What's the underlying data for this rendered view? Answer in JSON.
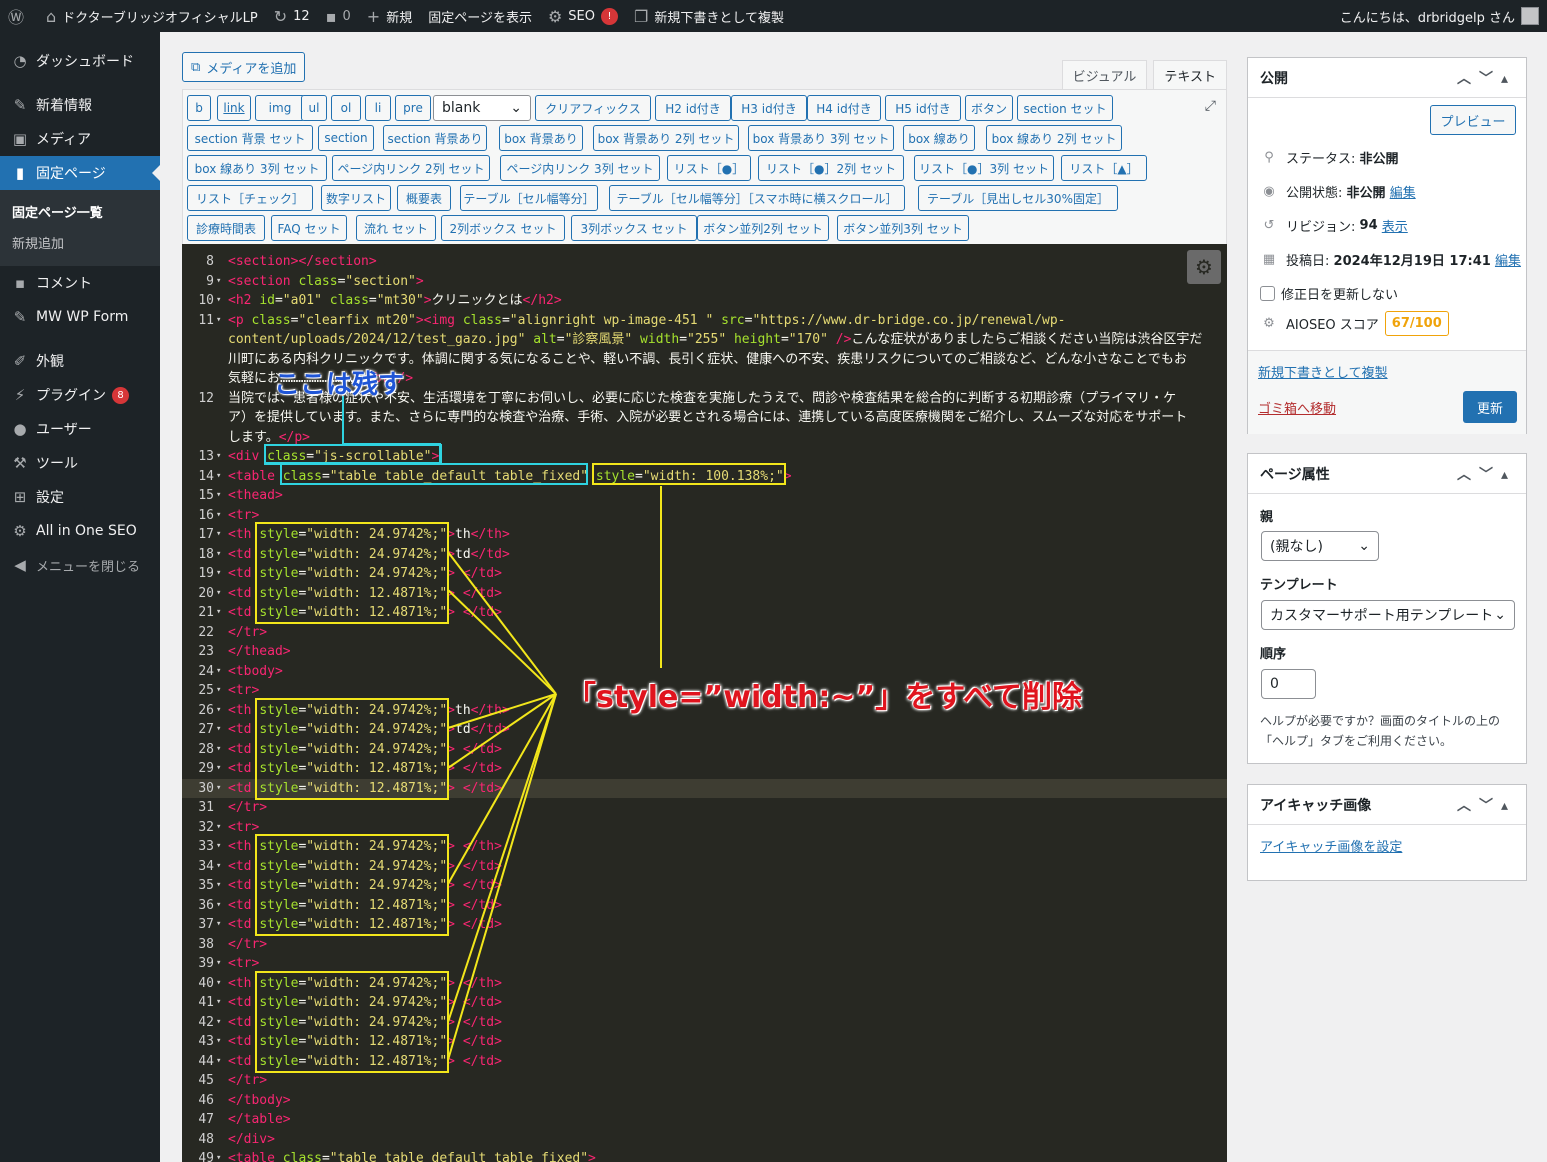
{
  "adminbar": {
    "site_name": "ドクターブリッジオフィシャルLP",
    "updates": "12",
    "comments": "0",
    "new": "新規",
    "view_page": "固定ページを表示",
    "seo": "SEO",
    "seo_badge": "!",
    "duplicate": "新規下書きとして複製",
    "greeting": "こんにちは、drbridgelp さん"
  },
  "sidebar": {
    "items": [
      {
        "label": "ダッシュボード",
        "icon": "dashboard-icon"
      },
      {
        "label": "新着情報",
        "icon": "pin-icon"
      },
      {
        "label": "メディア",
        "icon": "media-icon"
      },
      {
        "label": "固定ページ",
        "icon": "page-icon"
      },
      {
        "label": "コメント",
        "icon": "comment-icon"
      },
      {
        "label": "MW WP Form",
        "icon": "pin-icon"
      },
      {
        "label": "外観",
        "icon": "appearance-icon"
      },
      {
        "label": "プラグイン",
        "icon": "plugin-icon",
        "count": "8"
      },
      {
        "label": "ユーザー",
        "icon": "user-icon"
      },
      {
        "label": "ツール",
        "icon": "tool-icon"
      },
      {
        "label": "設定",
        "icon": "settings-icon"
      },
      {
        "label": "All in One SEO",
        "icon": "aioseo-icon"
      },
      {
        "label": "メニューを閉じる",
        "icon": "collapse-icon"
      }
    ],
    "submenu": [
      "固定ページ一覧",
      "新規追加"
    ]
  },
  "editor": {
    "add_media": "メディアを追加",
    "tab_visual": "ビジュアル",
    "tab_text": "テキスト",
    "quicktags": [
      "b",
      "link",
      "img",
      "ul",
      "ol",
      "li",
      "pre",
      "blank",
      "クリアフィックス",
      "H2 id付き",
      "H3 id付き",
      "H4 id付き",
      "H5 id付き",
      "ボタン",
      "section セット",
      "section 背景 セット",
      "section",
      "section 背景あり",
      "box 背景あり",
      "box 背景あり 2列 セット",
      "box 背景あり 3列 セット",
      "box 線あり",
      "box 線あり 2列 セット",
      "box 線あり 3列 セット",
      "ページ内リンク 2列 セット",
      "ページ内リンク 3列 セット",
      "リスト［●］",
      "リスト［●］2列 セット",
      "リスト［●］3列 セット",
      "リスト［▲］",
      "リスト［チェック］",
      "数字リスト",
      "概要表",
      "テーブル［セル幅等分］",
      "テーブル［セル幅等分］［スマホ時に横スクロール］",
      "テーブル［見出しセル30%固定］",
      "診療時間表",
      "FAQ セット",
      "流れ セット",
      "2列ボックス セット",
      "3列ボックス セット",
      "ボタン並列2列 セット",
      "ボタン並列3列 セット"
    ]
  },
  "code_lines": [
    {
      "n": "8",
      "a": "",
      "h": "<span class='tg'>&lt;section&gt;&lt;/section&gt;</span>"
    },
    {
      "n": "9",
      "a": "▾",
      "h": "<span class='tg'>&lt;section</span> <span class='at'>class</span>=<span class='st'>\"section\"</span><span class='tg'>&gt;</span>"
    },
    {
      "n": "10",
      "a": "▾",
      "h": "<span class='tg'>&lt;h2</span> <span class='at'>id</span>=<span class='st'>\"a01\"</span> <span class='at'>class</span>=<span class='st'>\"mt30\"</span><span class='tg'>&gt;</span>クリニックとは<span class='tg'>&lt;/h2&gt;</span>"
    },
    {
      "n": "11",
      "a": "▾",
      "h": "<span class='tg'>&lt;p</span> <span class='at'>class</span>=<span class='st'>\"clearfix mt20\"</span><span class='tg'>&gt;&lt;img</span> <span class='at'>class</span>=<span class='st'>\"alignright wp-image-451 \"</span> <span class='at'>src</span>=<span class='st'>\"https://www.dr-bridge.co.jp/renewal/wp-</span>"
    },
    {
      "n": "",
      "a": "",
      "h": "<span class='st'>content/uploads/2024/12/test_gazo.jpg\"</span> <span class='at'>alt</span>=<span class='st'>\"診察風景\"</span> <span class='at'>width</span>=<span class='st'>\"255\"</span> <span class='at'>height</span>=<span class='st'>\"170\"</span> <span class='tg'>/&gt;</span>こんな症状がありましたらご相談ください当院は渋谷区宇だ"
    },
    {
      "n": "",
      "a": "",
      "h": "川町にある内科クリニックです。体調に関する気になることや、軽い不調、長引く症状、健康への不安、疾患リスクについてのご相談など、どんな小さなことでもお"
    },
    {
      "n": "",
      "a": "",
      "h": "気軽にお……………………………<span class='tg'>&lt;br /&gt;</span>"
    },
    {
      "n": "12",
      "a": "",
      "h": "当院では、患者様の症状や不安、生活環境を丁寧にお伺いし、必要に応じた検査を実施したうえで、問診や検査結果を総合的に判断する初期診療（プライマリ・ケ"
    },
    {
      "n": "",
      "a": "",
      "h": "ア）を提供しています。また、さらに専門的な検査や治療、手術、入院が必要とされる場合には、連携している高度医療機関をご紹介し、スムーズな対応をサポート"
    },
    {
      "n": "",
      "a": "",
      "h": "します。<span class='tg'>&lt;/p&gt;</span>"
    },
    {
      "n": "13",
      "a": "▾",
      "h": "<span class='tg'>&lt;div</span> <span class='at'>class</span>=<span class='st'>\"js-scrollable\"</span><span class='tg'>&gt;</span>"
    },
    {
      "n": "14",
      "a": "▾",
      "h": "<span class='tg'>&lt;table</span> <span class='at'>class</span>=<span class='st'>\"table table_default table_fixed\"</span> <span class='at'>style</span>=<span class='st'>\"width: 100.138%;\"</span><span class='tg'>&gt;</span>"
    },
    {
      "n": "15",
      "a": "▾",
      "h": "<span class='tg'>&lt;thead&gt;</span>"
    },
    {
      "n": "16",
      "a": "▾",
      "h": "<span class='tg'>&lt;tr&gt;</span>"
    },
    {
      "n": "17",
      "a": "▾",
      "h": "<span class='tg'>&lt;th</span> <span class='at'>style</span>=<span class='st'>\"width: 24.9742%;\"</span><span class='tg'>&gt;</span>th<span class='tg'>&lt;/th&gt;</span>"
    },
    {
      "n": "18",
      "a": "▾",
      "h": "<span class='tg'>&lt;td</span> <span class='at'>style</span>=<span class='st'>\"width: 24.9742%;\"</span><span class='tg'>&gt;</span>td<span class='tg'>&lt;/td&gt;</span>"
    },
    {
      "n": "19",
      "a": "▾",
      "h": "<span class='tg'>&lt;td</span> <span class='at'>style</span>=<span class='st'>\"width: 24.9742%;\"</span><span class='tg'>&gt;</span> <span class='tg'>&lt;/td&gt;</span>"
    },
    {
      "n": "20",
      "a": "▾",
      "h": "<span class='tg'>&lt;td</span> <span class='at'>style</span>=<span class='st'>\"width: 12.4871%;\"</span><span class='tg'>&gt;</span> <span class='tg'>&lt;/td&gt;</span>"
    },
    {
      "n": "21",
      "a": "▾",
      "h": "<span class='tg'>&lt;td</span> <span class='at'>style</span>=<span class='st'>\"width: 12.4871%;\"</span><span class='tg'>&gt;</span> <span class='tg'>&lt;/td&gt;</span>"
    },
    {
      "n": "22",
      "a": "",
      "h": "<span class='tg'>&lt;/tr&gt;</span>"
    },
    {
      "n": "23",
      "a": "",
      "h": "<span class='tg'>&lt;/thead&gt;</span>"
    },
    {
      "n": "24",
      "a": "▾",
      "h": "<span class='tg'>&lt;tbody&gt;</span>"
    },
    {
      "n": "25",
      "a": "▾",
      "h": "<span class='tg'>&lt;tr&gt;</span>"
    },
    {
      "n": "26",
      "a": "▾",
      "h": "<span class='tg'>&lt;th</span> <span class='at'>style</span>=<span class='st'>\"width: 24.9742%;\"</span><span class='tg'>&gt;</span>th<span class='tg'>&lt;/th&gt;</span>"
    },
    {
      "n": "27",
      "a": "▾",
      "h": "<span class='tg'>&lt;td</span> <span class='at'>style</span>=<span class='st'>\"width: 24.9742%;\"</span><span class='tg'>&gt;</span>td<span class='tg'>&lt;/td&gt;</span>"
    },
    {
      "n": "28",
      "a": "▾",
      "h": "<span class='tg'>&lt;td</span> <span class='at'>style</span>=<span class='st'>\"width: 24.9742%;\"</span><span class='tg'>&gt;</span> <span class='tg'>&lt;/td&gt;</span>"
    },
    {
      "n": "29",
      "a": "▾",
      "h": "<span class='tg'>&lt;td</span> <span class='at'>style</span>=<span class='st'>\"width: 12.4871%;\"</span><span class='tg'>&gt;</span> <span class='tg'>&lt;/td&gt;</span>"
    },
    {
      "n": "30",
      "a": "▾",
      "h": "<span class='tg'>&lt;td</span> <span class='at'>style</span>=<span class='st'>\"width: 12.4871%;\"</span><span class='tg'>&gt;</span> <span class='tg'>&lt;/td&gt;</span>",
      "hl": true
    },
    {
      "n": "31",
      "a": "",
      "h": "<span class='tg'>&lt;/tr&gt;</span>"
    },
    {
      "n": "32",
      "a": "▾",
      "h": "<span class='tg'>&lt;tr&gt;</span>"
    },
    {
      "n": "33",
      "a": "▾",
      "h": "<span class='tg'>&lt;th</span> <span class='at'>style</span>=<span class='st'>\"width: 24.9742%;\"</span><span class='tg'>&gt;</span> <span class='tg'>&lt;/th&gt;</span>"
    },
    {
      "n": "34",
      "a": "▾",
      "h": "<span class='tg'>&lt;td</span> <span class='at'>style</span>=<span class='st'>\"width: 24.9742%;\"</span><span class='tg'>&gt;</span> <span class='tg'>&lt;/td&gt;</span>"
    },
    {
      "n": "35",
      "a": "▾",
      "h": "<span class='tg'>&lt;td</span> <span class='at'>style</span>=<span class='st'>\"width: 24.9742%;\"</span><span class='tg'>&gt;</span> <span class='tg'>&lt;/td&gt;</span>"
    },
    {
      "n": "36",
      "a": "▾",
      "h": "<span class='tg'>&lt;td</span> <span class='at'>style</span>=<span class='st'>\"width: 12.4871%;\"</span><span class='tg'>&gt;</span> <span class='tg'>&lt;/td&gt;</span>"
    },
    {
      "n": "37",
      "a": "▾",
      "h": "<span class='tg'>&lt;td</span> <span class='at'>style</span>=<span class='st'>\"width: 12.4871%;\"</span><span class='tg'>&gt;</span> <span class='tg'>&lt;/td&gt;</span>"
    },
    {
      "n": "38",
      "a": "",
      "h": "<span class='tg'>&lt;/tr&gt;</span>"
    },
    {
      "n": "39",
      "a": "▾",
      "h": "<span class='tg'>&lt;tr&gt;</span>"
    },
    {
      "n": "40",
      "a": "▾",
      "h": "<span class='tg'>&lt;th</span> <span class='at'>style</span>=<span class='st'>\"width: 24.9742%;\"</span><span class='tg'>&gt;</span> <span class='tg'>&lt;/th&gt;</span>"
    },
    {
      "n": "41",
      "a": "▾",
      "h": "<span class='tg'>&lt;td</span> <span class='at'>style</span>=<span class='st'>\"width: 24.9742%;\"</span><span class='tg'>&gt;</span> <span class='tg'>&lt;/td&gt;</span>"
    },
    {
      "n": "42",
      "a": "▾",
      "h": "<span class='tg'>&lt;td</span> <span class='at'>style</span>=<span class='st'>\"width: 24.9742%;\"</span><span class='tg'>&gt;</span> <span class='tg'>&lt;/td&gt;</span>"
    },
    {
      "n": "43",
      "a": "▾",
      "h": "<span class='tg'>&lt;td</span> <span class='at'>style</span>=<span class='st'>\"width: 12.4871%;\"</span><span class='tg'>&gt;</span> <span class='tg'>&lt;/td&gt;</span>"
    },
    {
      "n": "44",
      "a": "▾",
      "h": "<span class='tg'>&lt;td</span> <span class='at'>style</span>=<span class='st'>\"width: 12.4871%;\"</span><span class='tg'>&gt;</span> <span class='tg'>&lt;/td&gt;</span>"
    },
    {
      "n": "45",
      "a": "",
      "h": "<span class='tg'>&lt;/tr&gt;</span>"
    },
    {
      "n": "46",
      "a": "",
      "h": "<span class='tg'>&lt;/tbody&gt;</span>"
    },
    {
      "n": "47",
      "a": "",
      "h": "<span class='tg'>&lt;/table&gt;</span>"
    },
    {
      "n": "48",
      "a": "",
      "h": "<span class='tg'>&lt;/div&gt;</span>"
    },
    {
      "n": "49",
      "a": "▾",
      "h": "<span class='tg'>&lt;table</span> <span class='at'>class</span>=<span class='st'>\"table table_default table_fixed\"</span><span class='tg'>&gt;</span>"
    }
  ],
  "annotations": {
    "keep": "ここは残す",
    "delete_all": "「style=”width:~”」をすべて削除"
  },
  "publish": {
    "title": "公開",
    "preview": "プレビュー",
    "status_label": "ステータス:",
    "status_value": "非公開",
    "visibility_label": "公開状態:",
    "visibility_value": "非公開",
    "visibility_edit": "編集",
    "revisions_label": "リビジョン:",
    "revisions_value": "94",
    "revisions_link": "表示",
    "date_label": "投稿日:",
    "date_value": "2024年12月19日 17:41",
    "date_edit": "編集",
    "no_update_date": "修正日を更新しない",
    "aioseo_label": "AIOSEO スコア",
    "aioseo_score": "67/100",
    "duplicate_link": "新規下書きとして複製",
    "trash_link": "ゴミ箱へ移動",
    "update_button": "更新"
  },
  "page_attributes": {
    "title": "ページ属性",
    "parent_label": "親",
    "parent_value": "(親なし)",
    "template_label": "テンプレート",
    "template_value": "カスタマーサポート用テンプレート",
    "order_label": "順序",
    "order_value": "0",
    "help": "ヘルプが必要ですか？画面のタイトルの上の「ヘルプ」タブをご利用ください。"
  },
  "featured_image": {
    "title": "アイキャッチ画像",
    "set_link": "アイキャッチ画像を設定"
  },
  "colors": {
    "accent": "#2271b1",
    "highlight_yellow": "#f2e61b",
    "highlight_cyan": "#2fd3e0",
    "annotation_red": "#e0141e",
    "annotation_blue": "#1f55d6"
  }
}
